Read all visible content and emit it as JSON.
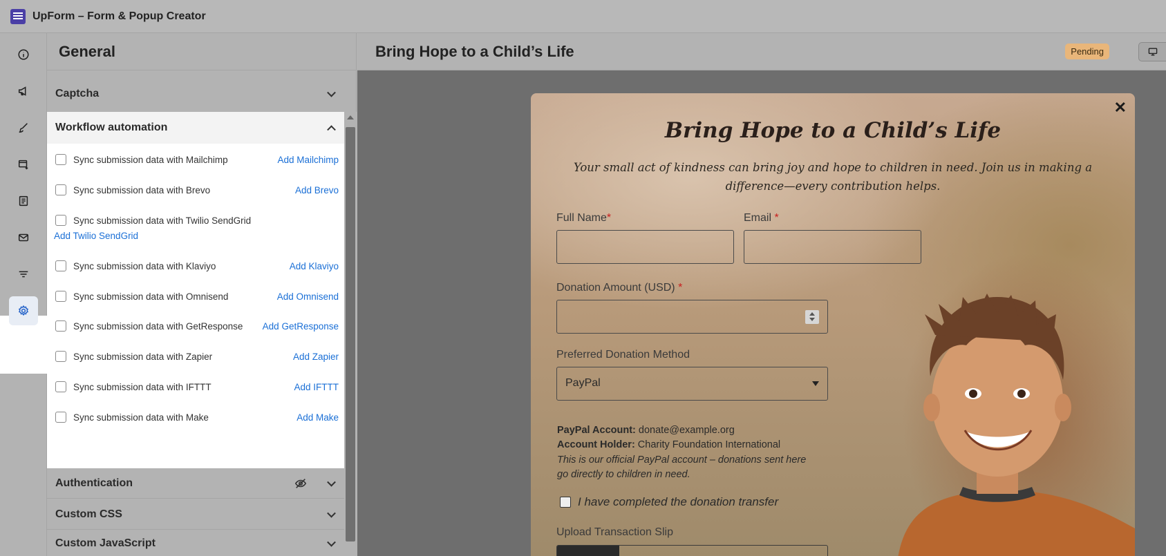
{
  "app": {
    "title": "UpForm – Form & Popup Creator"
  },
  "rail": {
    "items": [
      "info-icon",
      "megaphone-icon",
      "brush-icon",
      "form-add-icon",
      "receipt-icon",
      "mail-icon",
      "filter-icon",
      "gear-icon"
    ],
    "active": "gear-icon"
  },
  "panel": {
    "title": "General",
    "sections": {
      "captcha": "Captcha",
      "workflow": "Workflow automation",
      "authentication": "Authentication",
      "custom_css": "Custom CSS",
      "custom_js": "Custom JavaScript"
    },
    "workflow_items": [
      {
        "label": "Sync submission data with Mailchimp",
        "link": "Add Mailchimp"
      },
      {
        "label": "Sync submission data with Brevo",
        "link": "Add Brevo"
      },
      {
        "label": "Sync submission data with Twilio SendGrid",
        "link": "Add Twilio SendGrid"
      },
      {
        "label": "Sync submission data with Klaviyo",
        "link": "Add Klaviyo"
      },
      {
        "label": "Sync submission data with Omnisend",
        "link": "Add Omnisend"
      },
      {
        "label": "Sync submission data with GetResponse",
        "link": "Add GetResponse"
      },
      {
        "label": "Sync submission data with Zapier",
        "link": "Add Zapier"
      },
      {
        "label": "Sync submission data with IFTTT",
        "link": "Add IFTTT"
      },
      {
        "label": "Sync submission data with Make",
        "link": "Add Make"
      }
    ]
  },
  "preview": {
    "title": "Bring Hope to a Child’s Life",
    "status": "Pending",
    "popup": {
      "heading": "Bring Hope to a Child’s Life",
      "subheading": "Your small act of kindness can bring joy and hope to children in need. Join us in making a difference—every contribution helps.",
      "full_name_label": "Full Name",
      "email_label": "Email ",
      "amount_label": "Donation Amount (USD) ",
      "required_mark": "*",
      "method_label": "Preferred Donation Method",
      "method_value": "PayPal",
      "paypal_account_label": "PayPal Account:",
      "paypal_account_value": " donate@example.org",
      "holder_label": "Account Holder:",
      "holder_value": " Charity Foundation International",
      "note": "This is our official PayPal account – donations sent here go directly to children in need.",
      "transfer_checkbox": "I have completed the donation transfer",
      "upload_label": "Upload Transaction Slip",
      "close": "✕"
    }
  }
}
